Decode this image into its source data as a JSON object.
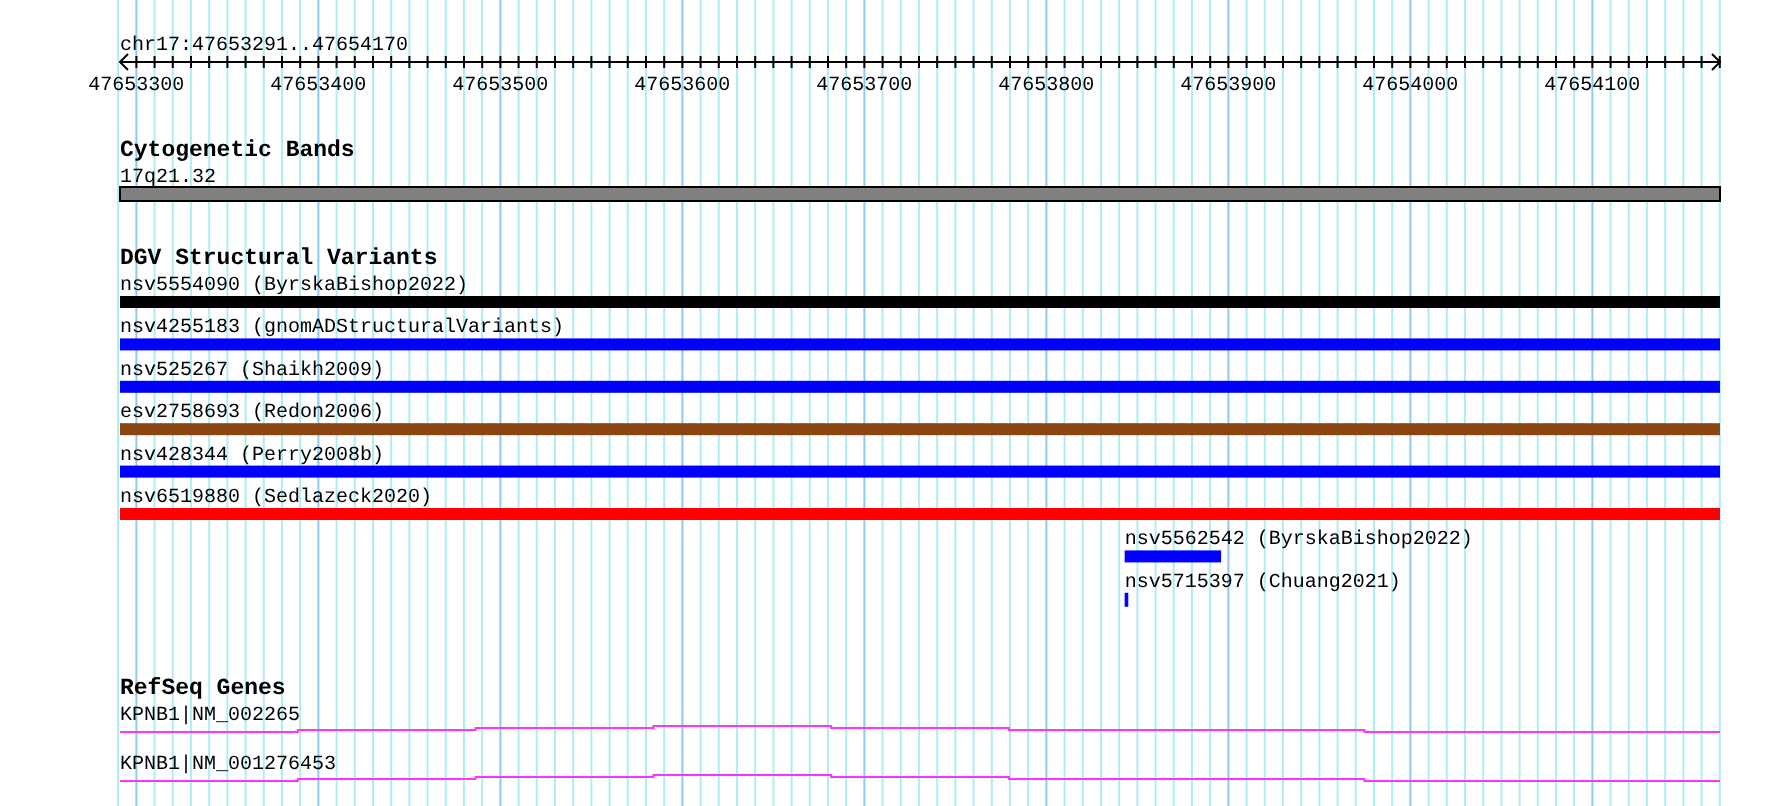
{
  "region": "chr17:47653291..47654170",
  "ruler": {
    "ticks": [
      "47653300",
      "47653400",
      "47653500",
      "47653600",
      "47653700",
      "47653800",
      "47653900",
      "47654000",
      "47654100"
    ]
  },
  "cytogenetic_bands": {
    "title": "Cytogenetic Bands",
    "bands": [
      {
        "name": "17q21.32"
      }
    ]
  },
  "dgv_structural_variants": {
    "title": "DGV Structural Variants",
    "variants": [
      {
        "label": "nsv5554090 (ByrskaBishop2022)",
        "color": "#000000"
      },
      {
        "label": "nsv4255183 (gnomADStructuralVariants)",
        "color": "#0000ff"
      },
      {
        "label": "nsv525267 (Shaikh2009)",
        "color": "#0000ff"
      },
      {
        "label": "esv2758693 (Redon2006)",
        "color": "#8b4513"
      },
      {
        "label": "nsv428344 (Perry2008b)",
        "color": "#0000ff"
      },
      {
        "label": "nsv6519880 (Sedlazeck2020)",
        "color": "#ff0000"
      },
      {
        "label": "nsv5562542 (ByrskaBishop2022)",
        "color": "#0000ff"
      },
      {
        "label": "nsv5715397 (Chuang2021)",
        "color": "#0000ff"
      }
    ]
  },
  "refseq_genes": {
    "title": "RefSeq Genes",
    "genes": [
      {
        "label": "KPNB1|NM_002265"
      },
      {
        "label": "KPNB1|NM_001276453"
      }
    ]
  }
}
